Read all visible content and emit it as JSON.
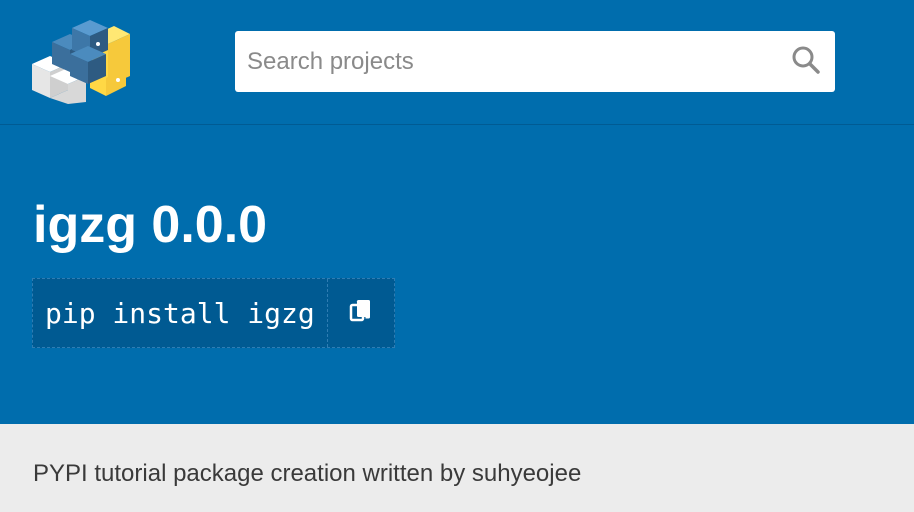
{
  "header": {
    "logo_icon": "pypi-logo-icon",
    "search": {
      "placeholder": "Search projects",
      "value": "",
      "icon": "search-icon"
    }
  },
  "package": {
    "title": "igzg 0.0.0",
    "install_command": "pip install igzg",
    "copy_icon": "copy-icon"
  },
  "description": {
    "summary": "PYPI tutorial package creation written by suhyeojee"
  },
  "colors": {
    "header_bg": "#006dad",
    "command_bg": "#005a92",
    "description_bg": "#ececec"
  }
}
